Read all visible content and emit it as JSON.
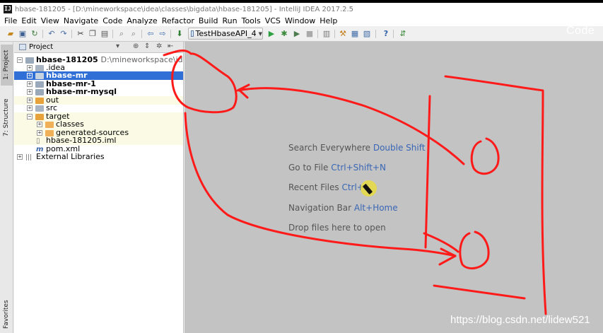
{
  "window": {
    "title": "hbase-181205 - [D:\\mineworkspace\\idea\\classes\\bigdata\\hbase-181205] - IntelliJ IDEA 2017.2.5",
    "app_icon_letter": "IJ"
  },
  "menu": [
    "File",
    "Edit",
    "View",
    "Navigate",
    "Code",
    "Analyze",
    "Refactor",
    "Build",
    "Run",
    "Tools",
    "VCS",
    "Window",
    "Help"
  ],
  "toolbar": {
    "run_config": "TestHbaseAPI_4",
    "icons": [
      "open-icon",
      "save-all-icon",
      "sync-icon",
      "undo-icon",
      "redo-icon",
      "cut-icon",
      "copy-icon",
      "paste-icon",
      "find-icon",
      "replace-icon",
      "back-icon",
      "forward-icon",
      "build-icon",
      "run-icon",
      "debug-icon",
      "coverage-icon",
      "stop-icon",
      "project-structure-icon",
      "settings-icon",
      "sdk-icon",
      "help-icon",
      "vcs-icon"
    ]
  },
  "brand_overlay": "Code",
  "left_strip": {
    "tabs": [
      "1: Project",
      "7: Structure",
      "Favorites"
    ]
  },
  "project_panel": {
    "title": "Project",
    "tree": [
      {
        "label": "hbase-181205",
        "path": "D:\\mineworkspace\\idea\\cla",
        "bold": true,
        "level": 0,
        "icon": "module"
      },
      {
        "label": ".idea",
        "level": 1,
        "icon": "plain"
      },
      {
        "label": "hbase-mr",
        "bold": true,
        "level": 1,
        "icon": "module",
        "selected": true
      },
      {
        "label": "hbase-mr-1",
        "bold": true,
        "level": 1,
        "icon": "module"
      },
      {
        "label": "hbase-mr-mysql",
        "bold": true,
        "level": 1,
        "icon": "module"
      },
      {
        "label": "out",
        "level": 1,
        "icon": "orange",
        "highlight": true
      },
      {
        "label": "src",
        "level": 1,
        "icon": "plain"
      },
      {
        "label": "target",
        "level": 1,
        "icon": "orange",
        "highlight": true
      },
      {
        "label": "classes",
        "level": 2,
        "icon": "orange",
        "highlight": true
      },
      {
        "label": "generated-sources",
        "level": 2,
        "icon": "orange",
        "highlight": true
      },
      {
        "label": "hbase-181205.iml",
        "level": 1,
        "icon": "iml",
        "highlight": true
      },
      {
        "label": "pom.xml",
        "level": 1,
        "icon": "maven"
      },
      {
        "label": "External Libraries",
        "level": 0,
        "icon": "libraries"
      }
    ]
  },
  "editor": {
    "hints": [
      {
        "text": "Search Everywhere",
        "key": "Double Shift"
      },
      {
        "text": "Go to File",
        "key": "Ctrl+Shift+N"
      },
      {
        "text": "Recent Files",
        "key": "Ctrl+E"
      },
      {
        "text": "Navigation Bar",
        "key": "Alt+Home"
      },
      {
        "text": "Drop files here to open",
        "key": ""
      }
    ]
  },
  "watermark": "https://blog.csdn.net/lidew521",
  "colors": {
    "selection": "#2f6fd6",
    "editor_bg": "#c3c3c3",
    "shortcut": "#3966b5",
    "annotation": "#ff1a1a"
  }
}
